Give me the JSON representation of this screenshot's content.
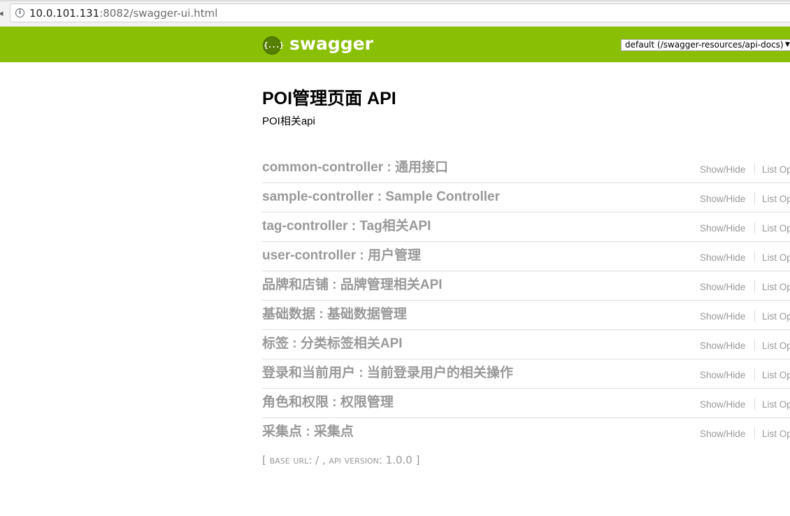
{
  "browser": {
    "url_host": "10.0.101.131",
    "url_rest": ":8082/swagger-ui.html"
  },
  "header": {
    "logo_glyph": "{...}",
    "logo_text": "swagger",
    "spec_selector": {
      "selected": "default (/swagger-resources/api-docs)",
      "arrow": "▼"
    },
    "colors": {
      "header_bg": "#89bf04",
      "logo_circle": "#547f00"
    }
  },
  "info": {
    "title": "POI管理页面 API",
    "description": "POI相关api"
  },
  "resources": [
    {
      "heading": "common-controller : 通用接口",
      "show_hide": "Show/Hide",
      "list_ops": "List Operations"
    },
    {
      "heading": "sample-controller : Sample Controller",
      "show_hide": "Show/Hide",
      "list_ops": "List Operations"
    },
    {
      "heading": "tag-controller : Tag相关API",
      "show_hide": "Show/Hide",
      "list_ops": "List Operations"
    },
    {
      "heading": "user-controller : 用户管理",
      "show_hide": "Show/Hide",
      "list_ops": "List Operations"
    },
    {
      "heading": "品牌和店铺 : 品牌管理相关API",
      "show_hide": "Show/Hide",
      "list_ops": "List Operations"
    },
    {
      "heading": "基础数据 : 基础数据管理",
      "show_hide": "Show/Hide",
      "list_ops": "List Operations"
    },
    {
      "heading": "标签 : 分类标签相关API",
      "show_hide": "Show/Hide",
      "list_ops": "List Operations"
    },
    {
      "heading": "登录和当前用户 : 当前登录用户的相关操作",
      "show_hide": "Show/Hide",
      "list_ops": "List Operations"
    },
    {
      "heading": "角色和权限 : 权限管理",
      "show_hide": "Show/Hide",
      "list_ops": "List Operations"
    },
    {
      "heading": "采集点 : 采集点",
      "show_hide": "Show/Hide",
      "list_ops": "List Operations"
    }
  ],
  "footer": {
    "open_bracket": "[",
    "base_url_label": "base url",
    "base_url_value": ": / ,",
    "api_version_label": "api version",
    "api_version_value": ": 1.0.0",
    "close_bracket": "]"
  }
}
